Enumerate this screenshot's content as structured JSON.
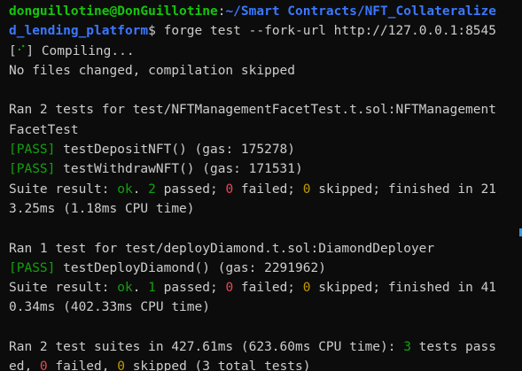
{
  "prompt": {
    "user_host": "donguillotine@DonGuillotine",
    "colon": ":",
    "path_part1": "~/Smart Contracts/NFT_Collateralize",
    "path_part2": "d_lending_platform",
    "symbol": "$ ",
    "command": "forge test --fork-url http://127.0.0.1:8545"
  },
  "compile": {
    "bracket_open": "[",
    "spinner": "⠊",
    "bracket_close": "] Compiling...",
    "status": "No files changed, compilation skipped"
  },
  "suite1": {
    "header_line1": "Ran 2 tests for test/NFTManagementFacetTest.t.sol:NFTManagement",
    "header_line2": "FacetTest",
    "tests": [
      {
        "tag": "[PASS]",
        "text": " testDepositNFT() (gas: 175278)"
      },
      {
        "tag": "[PASS]",
        "text": " testWithdrawNFT() (gas: 171531)"
      }
    ],
    "result_prefix": "Suite result: ",
    "ok": "ok",
    "passed_sep": ". ",
    "passed_num": "2",
    "passed_text": " passed; ",
    "failed_num": "0",
    "failed_text": " failed; ",
    "skipped_num": "0",
    "skipped_text": " skipped; finished in 21",
    "result_line2": "3.25ms (1.18ms CPU time)"
  },
  "suite2": {
    "header_line1": "Ran 1 test for test/deployDiamond.t.sol:DiamondDeployer",
    "tests": [
      {
        "tag": "[PASS]",
        "text": " testDeployDiamond() (gas: 2291962)"
      }
    ],
    "result_prefix": "Suite result: ",
    "ok": "ok",
    "passed_sep": ". ",
    "passed_num": "1",
    "passed_text": " passed; ",
    "failed_num": "0",
    "failed_text": " failed; ",
    "skipped_num": "0",
    "skipped_text": " skipped; finished in 41",
    "result_line2": "0.34ms (402.33ms CPU time)"
  },
  "summary": {
    "line1_prefix": "Ran 2 test suites in 427.61ms (623.60ms CPU time): ",
    "passed_num": "3",
    "line1_suffix": " tests pass",
    "line2_prefix": "ed, ",
    "failed_num": "0",
    "failed_text": " failed, ",
    "skipped_num": "0",
    "skipped_text": " skipped (3 total tests)"
  },
  "colors": {
    "background": "#0c0c0c",
    "foreground": "#cccccc",
    "user_green": "#16c60c",
    "path_blue": "#3b78ff",
    "pass_green": "#13a10e",
    "fail_red": "#e74856",
    "skip_yellow": "#c19c00"
  }
}
